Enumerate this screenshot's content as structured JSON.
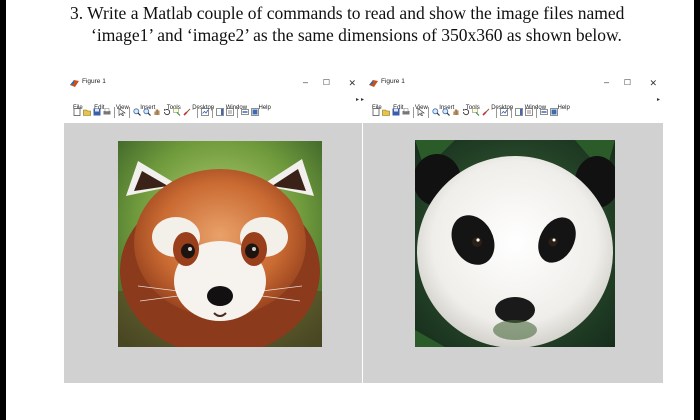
{
  "question": {
    "line1": "3. Write a Matlab couple of commands to read and show the image files named",
    "line2": "‘image1’ and ‘image2’ as the same dimensions of 350x360 as shown below."
  },
  "figures": [
    {
      "title": "Figure 1",
      "menus": [
        "File",
        "Edit",
        "View",
        "Insert",
        "Tools",
        "Desktop",
        "Window",
        "Help"
      ],
      "window_buttons": {
        "minimize": "–",
        "maximize": "☐",
        "close": "✕"
      },
      "image_subject": "red panda"
    },
    {
      "title": "Figure 1",
      "menus": [
        "File",
        "Edit",
        "View",
        "Insert",
        "Tools",
        "Desktop",
        "Window",
        "Help"
      ],
      "window_buttons": {
        "minimize": "–",
        "maximize": "☐",
        "close": "✕"
      },
      "image_subject": "giant panda"
    }
  ],
  "colors": {
    "axes_background": "#d1d1d1",
    "page_background": "#ffffff",
    "window_background": "#000000"
  }
}
